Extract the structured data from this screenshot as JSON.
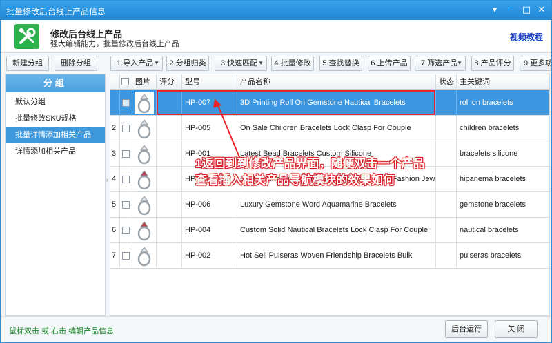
{
  "window": {
    "title": "批量修改后台线上产品信息"
  },
  "header": {
    "title": "修改后台线上产品",
    "subtitle": "强大编辑能力，批量修改后台线上产品",
    "video_link": "视频教程"
  },
  "toolbar": {
    "new_group": "新建分组",
    "delete_group": "删除分组",
    "import": "1.导入产品",
    "group_assign": "2.分组归类",
    "quick_match": "3.快速匹配",
    "batch_edit": "4.批量修改",
    "find_replace": "5.查找替换",
    "upload": "6.上传产品",
    "filter": "7.筛选产品",
    "rating": "8.产品评分",
    "more": "9.更多功"
  },
  "sidebar": {
    "header": "分组",
    "items": [
      {
        "label": "默认分组"
      },
      {
        "label": "批量修改SKU规格"
      },
      {
        "label": "批量详情添加相关产品"
      },
      {
        "label": "详情添加相关产品"
      }
    ]
  },
  "table": {
    "columns": [
      "图片",
      "评分",
      "型号",
      "产品名称",
      "状态",
      "主关键词"
    ],
    "rows": [
      {
        "num": "",
        "model": "HP-007",
        "name": "3D Printing Roll On Gemstone Nautical Bracelets",
        "status": "",
        "keyword": "roll on bracelets",
        "score": ""
      },
      {
        "num": "2",
        "model": "HP-005",
        "name": "On Sale Children Bracelets Lock Clasp For Couple",
        "status": "",
        "keyword": "children bracelets",
        "score": ""
      },
      {
        "num": "3",
        "model": "HP-001",
        "name": "Latest Bead Bracelets Custom Silicone",
        "status": "",
        "keyword": "bracelets silicone",
        "score": ""
      },
      {
        "num": "4",
        "model": "HP-003",
        "name": "Best Selling Hipanema Bracelets For Couple Fashion Jewelry",
        "status": "",
        "keyword": "hipanema bracelets",
        "score": ""
      },
      {
        "num": "5",
        "model": "HP-006",
        "name": "Luxury Gemstone Word Aquamarine Bracelets",
        "status": "",
        "keyword": "gemstone bracelets",
        "score": ""
      },
      {
        "num": "6",
        "model": "HP-004",
        "name": "Custom Solid Nautical Bracelets Lock Clasp For Couple",
        "status": "",
        "keyword": "nautical bracelets",
        "score": ""
      },
      {
        "num": "7",
        "model": "HP-002",
        "name": "Hot Sell Pulseras Woven Friendship Bracelets Bulk",
        "status": "",
        "keyword": "pulseras bracelets",
        "score": ""
      }
    ]
  },
  "annotation": {
    "line1": "1返回到到修改产品界面，随便双击一个产品",
    "line2": "查看插入相关产品导航模块的效果如何",
    "color": "#e8232a"
  },
  "status": {
    "hint": "鼠标双击 或 右击 编辑产品信息",
    "run_background": "后台运行",
    "close": "关 闭"
  },
  "colors": {
    "accent": "#3c97e0",
    "title_bar": "#2a93e0",
    "hint_green": "#1e8a2c"
  }
}
